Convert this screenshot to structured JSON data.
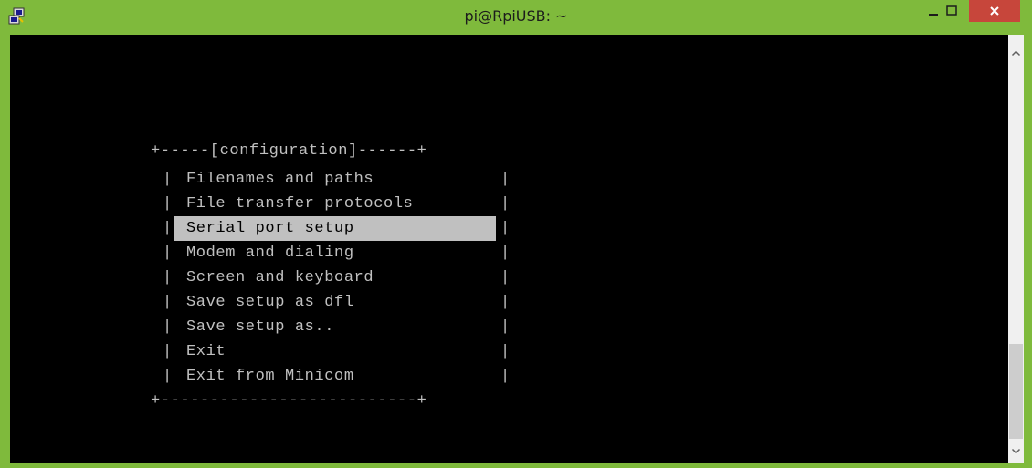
{
  "window": {
    "title": "pi@RpiUSB: ~",
    "accent_color": "#7fba3c",
    "close_color": "#c7463b",
    "icons": {
      "app": "putty-icon",
      "minimize": "minimize-icon",
      "maximize": "maximize-icon",
      "close": "close-icon"
    }
  },
  "terminal": {
    "background": "#000000",
    "foreground": "#c0c0c0",
    "menu": {
      "top_border": "+-----[configuration]------+",
      "bottom_border": "+--------------------------+",
      "items": [
        {
          "label": "Filenames and paths"
        },
        {
          "label": "File transfer protocols"
        },
        {
          "label": "Serial port setup",
          "selected": true
        },
        {
          "label": "Modem and dialing"
        },
        {
          "label": "Screen and keyboard"
        },
        {
          "label": "Save setup as dfl"
        },
        {
          "label": "Save setup as.."
        },
        {
          "label": "Exit"
        },
        {
          "label": "Exit from Minicom"
        }
      ],
      "side_char": "|"
    }
  },
  "scrollbar": {
    "up_icon": "scroll-up-arrow-icon",
    "down_icon": "scroll-down-arrow-icon"
  }
}
